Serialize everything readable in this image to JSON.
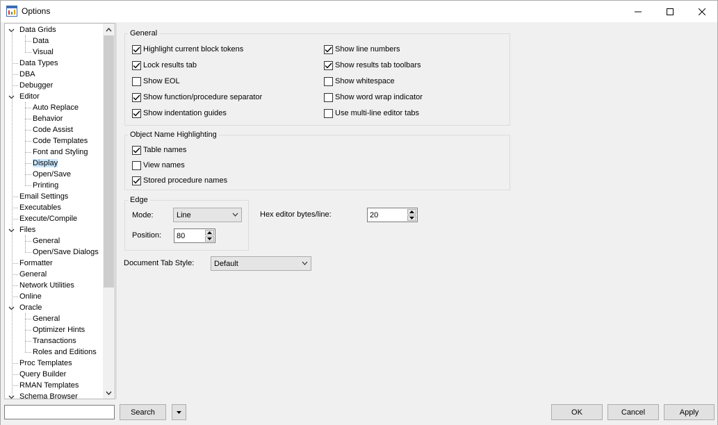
{
  "window": {
    "title": "Options"
  },
  "tree": {
    "items": [
      {
        "label": "Data Grids",
        "level": 0,
        "expand": "open"
      },
      {
        "label": "Data",
        "level": 1
      },
      {
        "label": "Visual",
        "level": 1
      },
      {
        "label": "Data Types",
        "level": 0
      },
      {
        "label": "DBA",
        "level": 0
      },
      {
        "label": "Debugger",
        "level": 0
      },
      {
        "label": "Editor",
        "level": 0,
        "expand": "open"
      },
      {
        "label": "Auto Replace",
        "level": 1
      },
      {
        "label": "Behavior",
        "level": 1
      },
      {
        "label": "Code Assist",
        "level": 1
      },
      {
        "label": "Code Templates",
        "level": 1
      },
      {
        "label": "Font and Styling",
        "level": 1
      },
      {
        "label": "Display",
        "level": 1,
        "selected": true
      },
      {
        "label": "Open/Save",
        "level": 1
      },
      {
        "label": "Printing",
        "level": 1
      },
      {
        "label": "Email Settings",
        "level": 0
      },
      {
        "label": "Executables",
        "level": 0
      },
      {
        "label": "Execute/Compile",
        "level": 0
      },
      {
        "label": "Files",
        "level": 0,
        "expand": "open"
      },
      {
        "label": "General",
        "level": 1
      },
      {
        "label": "Open/Save Dialogs",
        "level": 1
      },
      {
        "label": "Formatter",
        "level": 0
      },
      {
        "label": "General",
        "level": 0
      },
      {
        "label": "Network Utilities",
        "level": 0
      },
      {
        "label": "Online",
        "level": 0
      },
      {
        "label": "Oracle",
        "level": 0,
        "expand": "open"
      },
      {
        "label": "General",
        "level": 1
      },
      {
        "label": "Optimizer Hints",
        "level": 1
      },
      {
        "label": "Transactions",
        "level": 1
      },
      {
        "label": "Roles and Editions",
        "level": 1
      },
      {
        "label": "Proc Templates",
        "level": 0
      },
      {
        "label": "Query Builder",
        "level": 0
      },
      {
        "label": "RMAN Templates",
        "level": 0
      },
      {
        "label": "Schema Browser",
        "level": 0,
        "expand": "closed"
      }
    ]
  },
  "general": {
    "title": "General",
    "left": [
      {
        "label": "Highlight current block tokens",
        "checked": true
      },
      {
        "label": "Lock results tab",
        "checked": true
      },
      {
        "label": "Show EOL",
        "checked": false
      },
      {
        "label": "Show function/procedure separator",
        "checked": true
      },
      {
        "label": "Show indentation guides",
        "checked": true
      }
    ],
    "right": [
      {
        "label": "Show line numbers",
        "checked": true
      },
      {
        "label": "Show results tab toolbars",
        "checked": true
      },
      {
        "label": "Show whitespace",
        "checked": false
      },
      {
        "label": "Show word wrap indicator",
        "checked": false
      },
      {
        "label": "Use multi-line editor tabs",
        "checked": false
      }
    ]
  },
  "object_highlighting": {
    "title": "Object Name Highlighting",
    "items": [
      {
        "label": "Table names",
        "checked": true
      },
      {
        "label": "View names",
        "checked": false
      },
      {
        "label": "Stored procedure names",
        "checked": true
      }
    ]
  },
  "edge": {
    "title": "Edge",
    "mode_label": "Mode:",
    "mode_value": "Line",
    "position_label": "Position:",
    "position_value": "80"
  },
  "hex": {
    "label": "Hex editor bytes/line:",
    "value": "20"
  },
  "doc_tab": {
    "label": "Document Tab Style:",
    "value": "Default"
  },
  "buttons": {
    "search": "Search",
    "ok": "OK",
    "cancel": "Cancel",
    "apply": "Apply"
  },
  "colors": {
    "selection": "#cce8ff",
    "button_face": "#e1e1e1",
    "panel": "#f0f0f0"
  }
}
